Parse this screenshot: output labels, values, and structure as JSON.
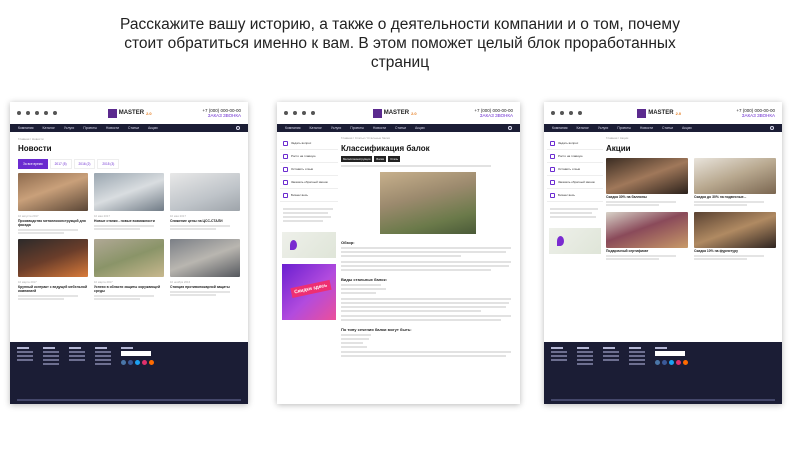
{
  "headline": "Расскажите вашу историю, а также о деятельности компании и о том, почему стоит обратиться именно к вам. В этом поможет целый блок проработанных страниц",
  "site": {
    "logo": "MASTER",
    "logo_sup": "2.0",
    "phone": "+7 (000) 000-00-00",
    "phone_link": "ЗАКАЗ ЗВОНКА",
    "nav": [
      "Компания",
      "Каталог",
      "Услуги",
      "Проекты",
      "Новости",
      "Статьи",
      "Акции"
    ]
  },
  "screens": {
    "news": {
      "breadcrumb": "Главная / Новости",
      "title": "Новости",
      "tabs": [
        "За все время",
        "2017 (5)",
        "2016 (2)",
        "2015 (3)"
      ],
      "cards": [
        {
          "date": "10 августа 2017",
          "title": "Производство металлоконструкций для фасада"
        },
        {
          "date": "10 мая 2017",
          "title": "Новые станки - новые возможности"
        },
        {
          "date": "10 мая 2017",
          "title": "Снижение цены на ЦСС-СТАЛИ"
        },
        {
          "date": "10 марта 2017",
          "title": "Крупный контракт с ведущей мебельной компанией"
        },
        {
          "date": "10 марта 2017",
          "title": "Успехи в области защиты окружающей среды"
        },
        {
          "date": "10 ноября 2016",
          "title": "Станция противопожарной защиты"
        }
      ]
    },
    "article": {
      "breadcrumb": "Главная / Статьи / Стальные балки",
      "title": "Классификация балок",
      "tags": [
        "Металлоконструкции",
        "Балки",
        "Сталь"
      ],
      "sidebar": [
        "Задать вопрос",
        "Росто на главную",
        "Оставить отзыв",
        "Заказать обратный звонок",
        "Бизнес весь"
      ],
      "promo_text": "Скидки здесь",
      "sections": [
        "Обзор:",
        "Виды стальных балок:",
        "По типу сечения балки могут быть:"
      ]
    },
    "promo": {
      "breadcrumb": "Главная / Акции",
      "title": "Акции",
      "cards": [
        {
          "title": "Скидка 30% на баллоны"
        },
        {
          "title": "Скидка до 30% на подвесные..."
        },
        {
          "title": "Подарочный сертификат"
        },
        {
          "title": "Скидка 10% на фурнитуру"
        }
      ]
    }
  },
  "footer": {
    "cols": [
      "Компания",
      "Услуги",
      "Каталог",
      "О нас"
    ],
    "subscribe": "Подписка",
    "copyright": "© 2017 Все права защищены"
  },
  "colors": {
    "accent": "#6b2bd0",
    "nav": "#1b1d35",
    "promo": "#ee2f72"
  }
}
